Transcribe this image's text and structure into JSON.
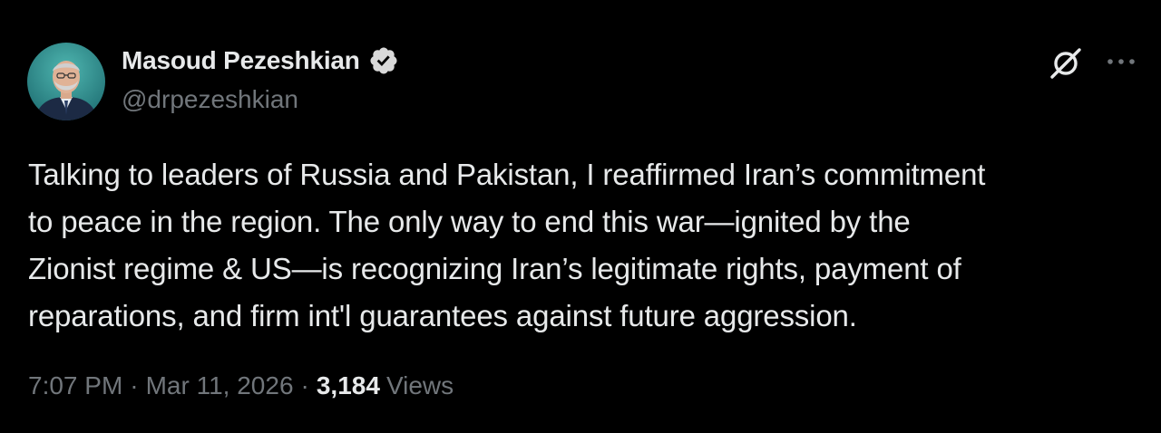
{
  "author": {
    "display_name": "Masoud Pezeshkian",
    "handle": "@drpezeshkian",
    "verified": true,
    "avatar_icon": "profile-photo"
  },
  "header_icons": {
    "grok": "grok-icon",
    "more": "more-options-icon"
  },
  "tweet": {
    "text": "Talking to leaders of Russia and Pakistan, I reaffirmed Iran’s commitment\nto peace in the region. The only way to end this war—ignited by the\nZionist regime & US—is recognizing Iran’s legitimate rights, payment of\nreparations, and firm int'l guarantees against future aggression.",
    "time": "7:07 PM",
    "separator": "·",
    "date": "Mar 11, 2026",
    "views_count": "3,184",
    "views_label": "Views"
  },
  "colors": {
    "background": "#000000",
    "primary_text": "#e7e9ea",
    "secondary_text": "#71767b",
    "verified_badge": "#d9d9d9"
  }
}
